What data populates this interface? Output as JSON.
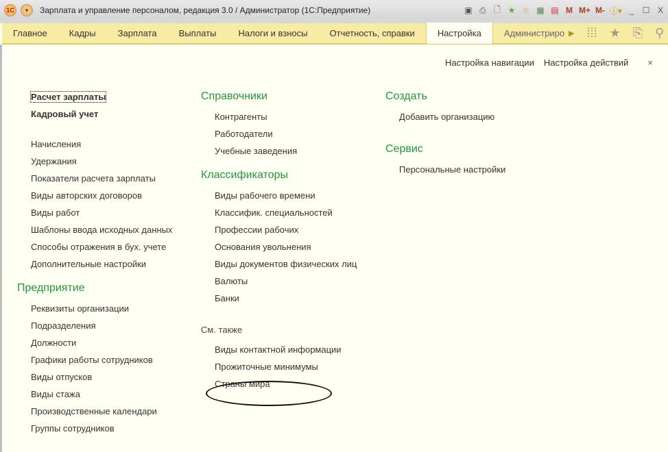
{
  "window": {
    "title": "Зарплата и управление персоналом, редакция 3.0 / Администратор  (1С:Предприятие)",
    "logo": "1С",
    "toolbar": [
      "save-icon",
      "print-icon",
      "preview-icon",
      "add-favorite-icon",
      "favorites-icon",
      "calculator-icon",
      "calendar-icon",
      "M",
      "M+",
      "M-",
      "info-icon",
      "minimize-icon",
      "maximize-icon",
      "close-icon"
    ],
    "m": "M",
    "mplus": "M+",
    "mminus": "M-"
  },
  "tabs": [
    "Главное",
    "Кадры",
    "Зарплата",
    "Выплаты",
    "Налоги и взносы",
    "Отчетность, справки",
    "Настройка",
    "Администриро"
  ],
  "active_tab": "Настройка",
  "header_links": {
    "nav": "Настройка навигации",
    "actions": "Настройка действий",
    "close": "×"
  },
  "col1": {
    "bold": [
      "Расчет зарплаты",
      "Кадровый учет"
    ],
    "items": [
      "Начисления",
      "Удержания",
      "Показатели расчета зарплаты",
      "Виды авторских договоров",
      "Виды работ",
      "Шаблоны ввода исходных данных",
      "Способы отражения в бух. учете",
      "Дополнительные настройки"
    ],
    "section": "Предприятие",
    "section_items": [
      "Реквизиты организации",
      "Подразделения",
      "Должности",
      "Графики работы сотрудников",
      "Виды отпусков",
      "Виды стажа",
      "Производственные календари",
      "Группы сотрудников"
    ]
  },
  "col2": {
    "s1": "Справочники",
    "s1_items": [
      "Контрагенты",
      "Работодатели",
      "Учебные заведения"
    ],
    "s2": "Классификаторы",
    "s2_items": [
      "Виды рабочего времени",
      "Классифик. специальностей",
      "Профессии рабочих",
      "Основания увольнения",
      "Виды документов физических лиц",
      "Валюты",
      "Банки"
    ],
    "see_also": "См. также",
    "see_items": [
      "Виды контактной информации",
      "Прожиточные минимумы",
      "Страны мира"
    ]
  },
  "col3": {
    "s1": "Создать",
    "s1_items": [
      "Добавить организацию"
    ],
    "s2": "Сервис",
    "s2_items": [
      "Персональные настройки"
    ]
  },
  "colors": {
    "section": "#1e9a3c",
    "tabbar": "#f8eba4"
  }
}
